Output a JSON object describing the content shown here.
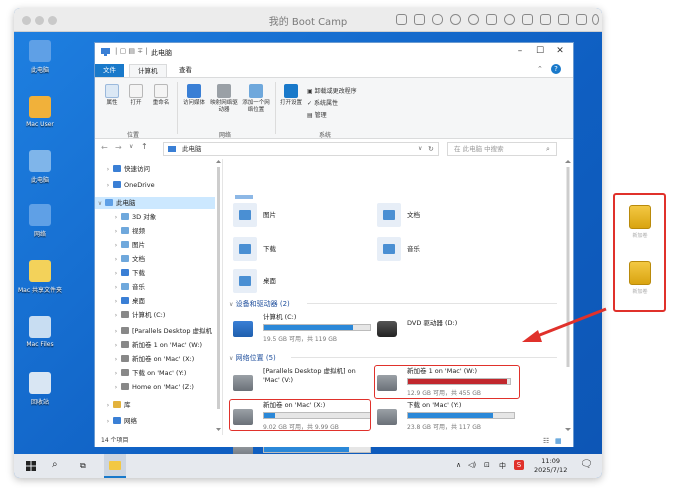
{
  "vm": {
    "title": "我的 Boot Camp"
  },
  "desktop_icons": [
    {
      "label": "此电脑",
      "color": "#5fa0e6"
    },
    {
      "label": "Mac User",
      "color": "#f1b13a"
    },
    {
      "label": "此电脑",
      "color": "#7fb5ea"
    },
    {
      "label": "网络",
      "color": "#5fa0e6"
    },
    {
      "label": "Mac 共享文件夹",
      "color": "#f3d25a"
    },
    {
      "label": "Mac Files",
      "color": "#c8ddf2"
    },
    {
      "label": "回收站",
      "color": "#d9e6f3"
    }
  ],
  "explorer": {
    "title": "此电脑",
    "tabs": [
      "文件",
      "计算机",
      "查看"
    ],
    "active_tab": "计算机",
    "ribbon": {
      "location": {
        "group": "位置",
        "buttons": [
          "属性",
          "打开",
          "重命名"
        ]
      },
      "network": {
        "group": "网络",
        "buttons": [
          "访问媒体",
          "映射网络驱动器",
          "添加一个网络位置"
        ]
      },
      "system": {
        "group": "系统",
        "open_settings": "打开设置",
        "items": [
          "卸载或更改程序",
          "系统属性",
          "管理"
        ]
      }
    },
    "address": "此电脑",
    "search_placeholder": "在 此电脑 中搜索",
    "nav": [
      {
        "label": "快速访问",
        "color": "#3a7fd5"
      },
      {
        "label": "OneDrive",
        "color": "#3a7fd5"
      },
      {
        "label": "此电脑",
        "color": "#5fa0e6"
      },
      {
        "label": "3D 对象",
        "color": "#6fa8dc"
      },
      {
        "label": "视频",
        "color": "#6fa8dc"
      },
      {
        "label": "图片",
        "color": "#6fa8dc"
      },
      {
        "label": "文档",
        "color": "#6fa8dc"
      },
      {
        "label": "下载",
        "color": "#3a7fd5"
      },
      {
        "label": "音乐",
        "color": "#6fa8dc"
      },
      {
        "label": "桌面",
        "color": "#3a7fd5"
      },
      {
        "label": "计算机 (C:)",
        "color": "#888888"
      },
      {
        "label": "[Parallels Desktop 虚拟机",
        "color": "#888888"
      },
      {
        "label": "新加卷 1 on 'Mac' (W:)",
        "color": "#888888"
      },
      {
        "label": "新加卷 on 'Mac' (X:)",
        "color": "#888888"
      },
      {
        "label": "下载 on 'Mac' (Y:)",
        "color": "#888888"
      },
      {
        "label": "Home on 'Mac' (Z:)",
        "color": "#888888"
      },
      {
        "label": "库",
        "color": "#e3b23c"
      },
      {
        "label": "网络",
        "color": "#3a7fd5"
      }
    ],
    "folders": [
      "图片",
      "文档",
      "下载",
      "音乐",
      "桌面"
    ],
    "devices_section": "设备和驱动器 (2)",
    "devices": [
      {
        "name": "计算机 (C:)",
        "size": "19.5 GB 可用，共 119 GB",
        "used": 0.84,
        "color": "#2b88d8"
      },
      {
        "name": "DVD 驱动器 (D:)",
        "size": "",
        "used": 0,
        "color": "#2b88d8"
      }
    ],
    "network_section": "网络位置 (5)",
    "network_drives": [
      {
        "name": "[Parallels Desktop 虚拟机] on 'Mac' (V:)",
        "size": "",
        "used": 0,
        "color": "#2b88d8"
      },
      {
        "name": "新加卷 1 on 'Mac' (W:)",
        "size": "12.9 GB 可用，共 455 GB",
        "used": 0.97,
        "color": "#c1272d"
      },
      {
        "name": "新加卷 on 'Mac' (X:)",
        "size": "9.02 GB 可用，共 9.99 GB",
        "used": 0.1,
        "color": "#2b88d8"
      },
      {
        "name": "下载 on 'Mac' (Y:)",
        "size": "23.8 GB 可用，共 117 GB",
        "used": 0.8,
        "color": "#2b88d8"
      },
      {
        "name": "Home on 'Mac' (Z:)",
        "size": "23.8 GB 可用，共 117 GB",
        "used": 0.8,
        "color": "#2b88d8"
      }
    ],
    "status": "14 个项目"
  },
  "taskbar": {
    "time": "11:09",
    "date": "2025/7/12",
    "ime": "中"
  },
  "external_drives": [
    {
      "label": "新加卷"
    },
    {
      "label": "新加卷"
    }
  ],
  "accent_colors": {
    "highlight": "#e0312b",
    "desktop": "#1669c9"
  }
}
